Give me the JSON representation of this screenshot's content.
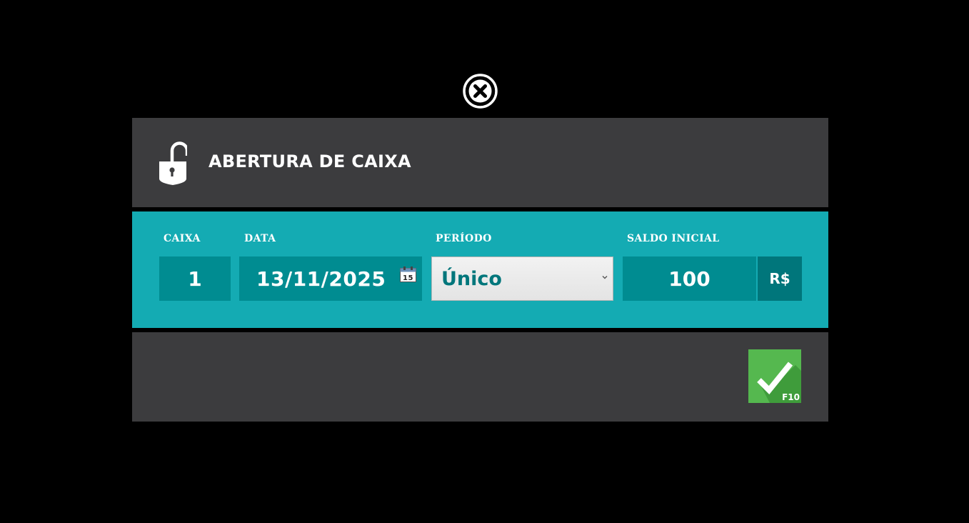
{
  "dialog": {
    "title": "ABERTURA DE CAIXA",
    "icons": {
      "close": "close-circle-icon",
      "header": "unlocked-padlock-icon",
      "calendar": "calendar-icon",
      "confirm": "checkmark-icon"
    },
    "colors": {
      "header_bg": "#3c3c3e",
      "form_bg": "#14abb3",
      "field_bg": "#008c91",
      "currency_bg": "#00767b",
      "confirm_bg": "#55b84f"
    }
  },
  "form": {
    "caixa": {
      "label": "CAIXA",
      "value": "1"
    },
    "data": {
      "label": "DATA",
      "value": "13/11/2025",
      "calendar_day": "15"
    },
    "periodo": {
      "label": "PERÍODO",
      "value": "Único"
    },
    "saldo": {
      "label": "SALDO INICIAL",
      "value": "100",
      "currency": "R$"
    }
  },
  "footer": {
    "confirm_shortcut": "F10"
  }
}
